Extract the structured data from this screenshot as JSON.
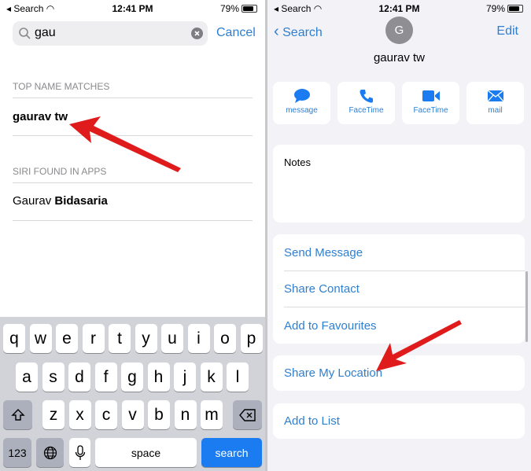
{
  "status": {
    "carrier": "Search",
    "time": "12:41 PM",
    "battery": "79%",
    "battery_level": 0.79
  },
  "left": {
    "search": {
      "value": "gau",
      "cancel": "Cancel"
    },
    "sections": [
      {
        "header": "TOP NAME MATCHES",
        "item": "gaurav tw"
      },
      {
        "header": "SIRI FOUND IN APPS",
        "item_plain": "Gaurav ",
        "item_bold": "Bidasaria"
      }
    ],
    "keyboard": {
      "row1": [
        "q",
        "w",
        "e",
        "r",
        "t",
        "y",
        "u",
        "i",
        "o",
        "p"
      ],
      "row2": [
        "a",
        "s",
        "d",
        "f",
        "g",
        "h",
        "j",
        "k",
        "l"
      ],
      "row3": [
        "z",
        "x",
        "c",
        "v",
        "b",
        "n",
        "m"
      ],
      "numbers": "123",
      "space": "space",
      "search": "search"
    }
  },
  "right": {
    "back": "Search",
    "edit": "Edit",
    "avatar_initial": "G",
    "name": "gaurav tw",
    "actions": [
      {
        "label": "message",
        "icon": "message-icon"
      },
      {
        "label": "FaceTime",
        "icon": "phone-icon"
      },
      {
        "label": "FaceTime",
        "icon": "video-icon"
      },
      {
        "label": "mail",
        "icon": "mail-icon"
      }
    ],
    "notes": "Notes",
    "rows": [
      "Send Message",
      "Share Contact",
      "Add to Favourites",
      "Share My Location",
      "Add to List"
    ]
  },
  "colors": {
    "accent": "#2f7fd0",
    "arrow": "#e01b1b",
    "search_key": "#1a7cf0"
  }
}
